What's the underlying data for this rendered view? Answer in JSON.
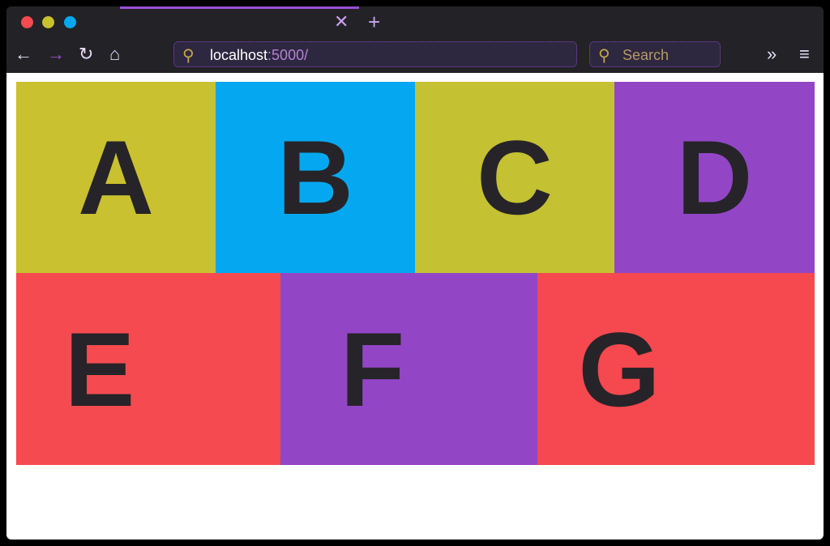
{
  "window": {
    "controls": {
      "close_color": "#f54b50",
      "minimize_color": "#c9c12f",
      "maximize_color": "#05a8f0"
    }
  },
  "tabs": {
    "close_icon": "close-icon",
    "new_tab_icon": "plus-icon"
  },
  "toolbar": {
    "url_host": "localhost",
    "url_rest": ":5000/",
    "search_placeholder": "Search"
  },
  "grid": {
    "cells": [
      {
        "label": "A",
        "color": "#c9c12f"
      },
      {
        "label": "B",
        "color": "#05a8f0"
      },
      {
        "label": "C",
        "color": "#c4c132"
      },
      {
        "label": "D",
        "color": "#9246c6"
      },
      {
        "label": "E",
        "color": "#f54b50"
      },
      {
        "label": "F",
        "color": "#9246c6"
      },
      {
        "label": "G",
        "color": "#f5484f"
      }
    ]
  }
}
